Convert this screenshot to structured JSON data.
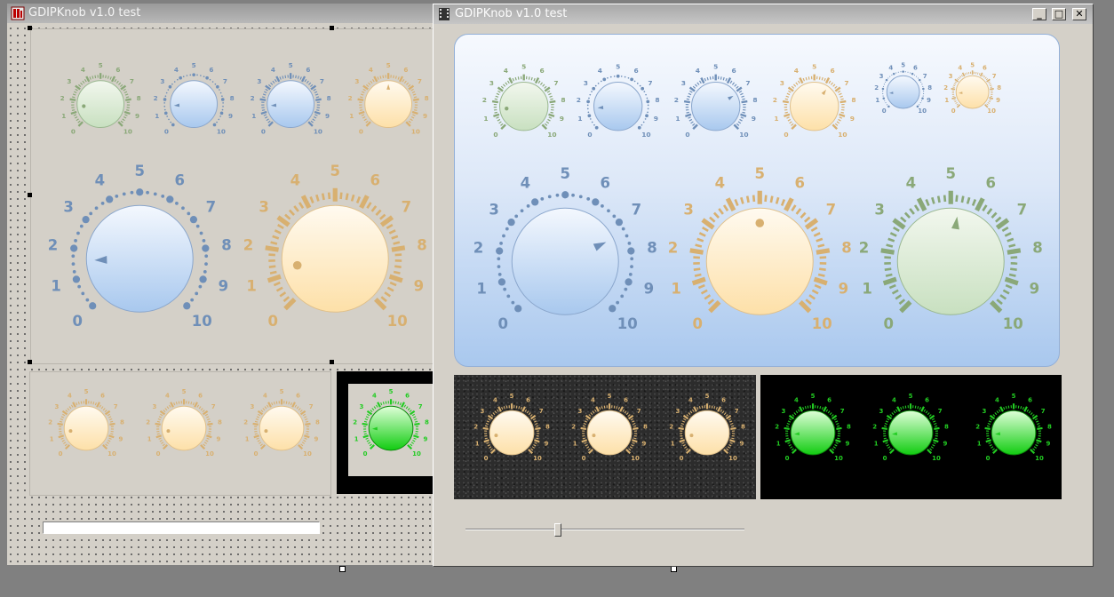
{
  "designer": {
    "title": "GDIPKnob v1.0 test"
  },
  "main": {
    "title": "GDIPKnob v1.0 test",
    "min_glyph": "_",
    "max_glyph": "□",
    "close_glyph": "✕"
  },
  "scale_labels": [
    "0",
    "1",
    "2",
    "3",
    "4",
    "5",
    "6",
    "7",
    "8",
    "9",
    "10"
  ],
  "colors": {
    "blue": "#6f8fb8",
    "orange": "#d8b070",
    "green": "#8aa878",
    "bright_green": "#22cc22"
  },
  "slider": {
    "value_fraction": 0.33
  }
}
